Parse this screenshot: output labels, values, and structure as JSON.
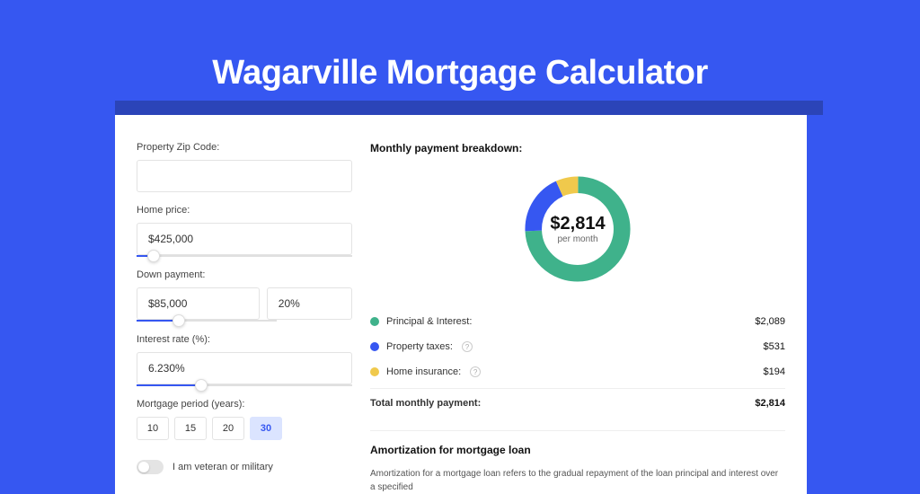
{
  "title": "Wagarville Mortgage Calculator",
  "colors": {
    "principal": "#3fb28b",
    "taxes": "#3657f1",
    "insurance": "#f0c94c"
  },
  "form": {
    "zip_label": "Property Zip Code:",
    "zip_value": "",
    "home_price_label": "Home price:",
    "home_price_value": "$425,000",
    "home_price_slider_pct": 8,
    "down_payment_label": "Down payment:",
    "down_payment_value": "$85,000",
    "down_payment_pct": "20%",
    "down_payment_slider_pct": 20,
    "rate_label": "Interest rate (%):",
    "rate_value": "6.230%",
    "rate_slider_pct": 30,
    "period_label": "Mortgage period (years):",
    "periods": [
      "10",
      "15",
      "20",
      "30"
    ],
    "period_selected": "30",
    "veteran_label": "I am veteran or military"
  },
  "breakdown": {
    "title": "Monthly payment breakdown:",
    "center_amount": "$2,814",
    "center_sub": "per month",
    "items": [
      {
        "label": "Principal & Interest:",
        "value": "$2,089",
        "color": "#3fb28b",
        "info": false
      },
      {
        "label": "Property taxes:",
        "value": "$531",
        "color": "#3657f1",
        "info": true
      },
      {
        "label": "Home insurance:",
        "value": "$194",
        "color": "#f0c94c",
        "info": true
      }
    ],
    "total_label": "Total monthly payment:",
    "total_value": "$2,814"
  },
  "amortization": {
    "title": "Amortization for mortgage loan",
    "body": "Amortization for a mortgage loan refers to the gradual repayment of the loan principal and interest over a specified"
  },
  "chart_data": {
    "type": "pie",
    "title": "Monthly payment breakdown",
    "series": [
      {
        "name": "Principal & Interest",
        "value": 2089
      },
      {
        "name": "Property taxes",
        "value": 531
      },
      {
        "name": "Home insurance",
        "value": 194
      }
    ],
    "total": 2814
  }
}
